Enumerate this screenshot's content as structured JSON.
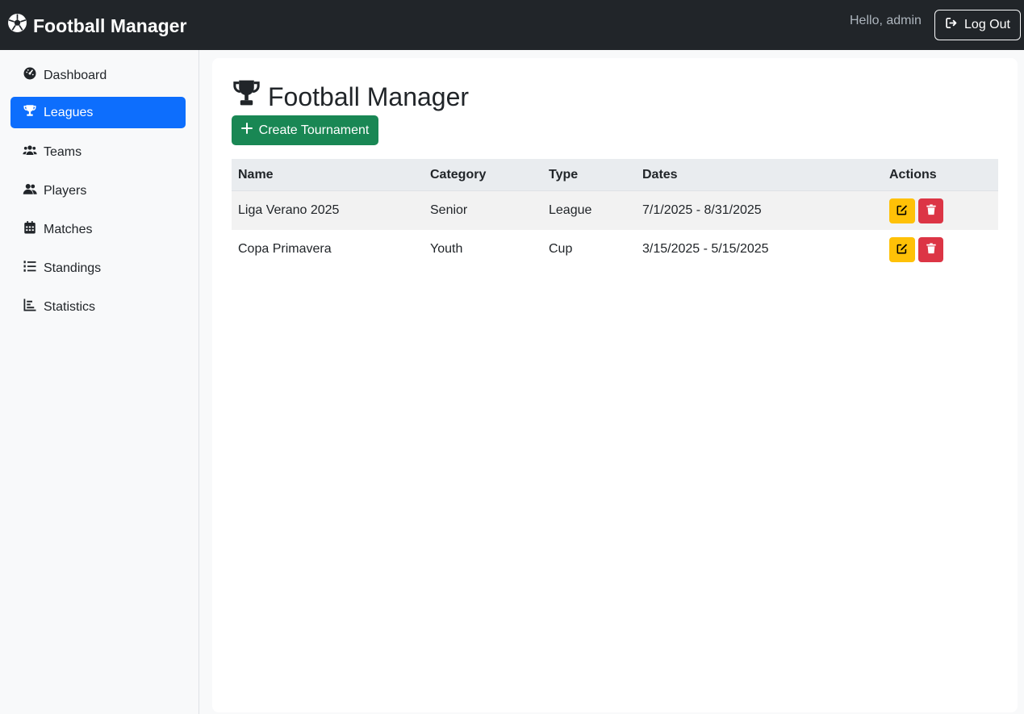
{
  "navbar": {
    "brand": "Football Manager",
    "greeting": "Hello, admin",
    "logout_label": "Log Out"
  },
  "sidebar": {
    "items": [
      {
        "label": "Dashboard",
        "icon": "gauge-icon"
      },
      {
        "label": "Leagues",
        "icon": "trophy-icon",
        "active": true
      },
      {
        "label": "Teams",
        "icon": "users-icon"
      },
      {
        "label": "Players",
        "icon": "user-group-icon"
      },
      {
        "label": "Matches",
        "icon": "calendar-icon"
      },
      {
        "label": "Standings",
        "icon": "list-ol-icon"
      },
      {
        "label": "Statistics",
        "icon": "chart-bar-icon"
      }
    ]
  },
  "main": {
    "title": "Football Manager",
    "create_label": "Create Tournament",
    "table": {
      "headers": [
        "Name",
        "Category",
        "Type",
        "Dates",
        "Actions"
      ],
      "rows": [
        {
          "name": "Liga Verano 2025",
          "category": "Senior",
          "type": "League",
          "dates": "7/1/2025 - 8/31/2025"
        },
        {
          "name": "Copa Primavera",
          "category": "Youth",
          "type": "Cup",
          "dates": "3/15/2025 - 5/15/2025"
        }
      ]
    }
  },
  "colors": {
    "navbar": "#212529",
    "active": "#0d6efd",
    "create": "#198754",
    "edit": "#ffc107",
    "delete": "#dc3545"
  }
}
